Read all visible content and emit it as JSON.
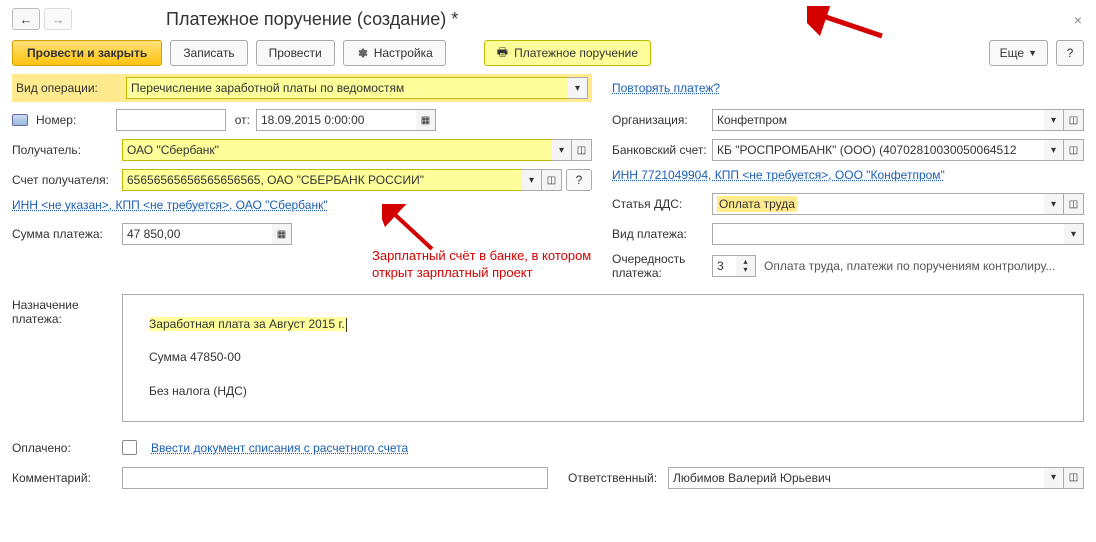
{
  "title": "Платежное поручение (создание) *",
  "toolbar": {
    "post_close": "Провести и закрыть",
    "write": "Записать",
    "post": "Провести",
    "settings": "Настройка",
    "payment_order": "Платежное поручение",
    "more": "Еще",
    "help": "?"
  },
  "repeat_link": "Повторять платеж?",
  "fields": {
    "op_type_label": "Вид операции:",
    "op_type_value": "Перечисление заработной платы по ведомостям",
    "number_label": "Номер:",
    "from_label": "от:",
    "date_value": "18.09.2015  0:00:00",
    "recipient_label": "Получатель:",
    "recipient_value": "ОАО \"Сбербанк\"",
    "rec_account_label": "Счет получателя:",
    "rec_account_value": "65656565656565656565, ОАО \"СБЕРБАНК РОССИИ\"",
    "rec_account_help": "?",
    "inn_link": "ИНН <не указан>, КПП <не требуется>, ОАО \"Сбербанк\"",
    "amount_label": "Сумма платежа:",
    "amount_value": "47 850,00",
    "purpose_label": "Назначение платежа:",
    "purpose_line1": "Заработная плата за Август 2015 г.",
    "purpose_line2": "Сумма 47850-00",
    "purpose_line3": "Без налога (НДС)",
    "paid_label": "Оплачено:",
    "paid_link": "Ввести документ списания с расчетного счета",
    "comment_label": "Комментарий:"
  },
  "right": {
    "org_label": "Организация:",
    "org_value": "Конфетпром",
    "bank_label": "Банковский счет:",
    "bank_value": "КБ \"РОСПРОМБАНК\" (ООО) (40702810030050064512",
    "inn_link": "ИНН 7721049904, КПП <не требуется>, ООО \"Конфетпром\"",
    "dds_label": "Статья ДДС:",
    "dds_value": "Оплата труда",
    "pay_type_label": "Вид платежа:",
    "priority_label": "Очередность платежа:",
    "priority_value": "3",
    "priority_text": "Оплата труда, платежи по поручениям контролиру...",
    "resp_label": "Ответственный:",
    "resp_value": "Любимов Валерий Юрьевич"
  },
  "annotations": {
    "red_note": "Зарплатный счёт в банке, в котором открыт зарплатный проект"
  }
}
